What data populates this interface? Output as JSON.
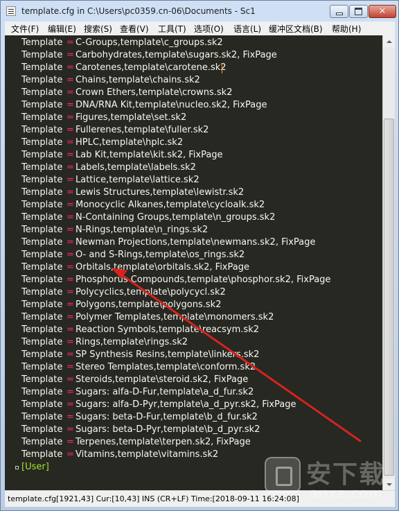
{
  "window": {
    "title": "template.cfg in C:\\Users\\pc0359.cn-06\\Documents - Sc1",
    "close_glyph": "✕"
  },
  "menu": [
    {
      "label": "文件(F)",
      "name": "menu-file"
    },
    {
      "label": "编辑(E)",
      "name": "menu-edit"
    },
    {
      "label": "搜索(S)",
      "name": "menu-search"
    },
    {
      "label": "查看(V)",
      "name": "menu-view"
    },
    {
      "label": "工具(T)",
      "name": "menu-tools"
    },
    {
      "label": "选项(O)",
      "name": "menu-options"
    },
    {
      "label": "语言(L)",
      "name": "menu-language"
    },
    {
      "label": "缓冲区文档(B)",
      "name": "menu-buffers"
    },
    {
      "label": "帮助(H)",
      "name": "menu-help"
    }
  ],
  "editor": {
    "key": "Template",
    "eq": "=",
    "lines": [
      "C-Groups,template\\c_groups.sk2",
      "Carbohydrates,template\\sugars.sk2, FixPage",
      "Carotenes,template\\carotene.sk2",
      "Chains,template\\chains.sk2",
      "Crown Ethers,template\\crowns.sk2",
      "DNA/RNA Kit,template\\nucleo.sk2, FixPage",
      "Figures,template\\set.sk2",
      "Fullerenes,template\\fuller.sk2",
      "HPLC,template\\hplc.sk2",
      "Lab Kit,template\\kit.sk2, FixPage",
      "Labels,template\\labels.sk2",
      "Lattice,template\\lattice.sk2",
      "Lewis Structures,template\\lewistr.sk2",
      "Monocyclic Alkanes,template\\cycloalk.sk2",
      "N-Containing Groups,template\\n_groups.sk2",
      "N-Rings,template\\n_rings.sk2",
      "Newman Projections,template\\newmans.sk2, FixPage",
      "O- and S-Rings,template\\os_rings.sk2",
      "Orbitals,template\\orbitals.sk2, FixPage",
      "Phosphorus Compounds,template\\phosphor.sk2, FixPage",
      "Polycyclics,template\\polycycl.sk2",
      "Polygons,template\\polygons.sk2",
      "Polymer Templates,template\\monomers.sk2",
      "Reaction Symbols,template\\reacsym.sk2",
      "Rings,template\\rings.sk2",
      "SP Synthesis Resins,template\\linkers.sk2",
      "Stereo Templates,template\\conform.sk2",
      "Steroids,template\\steroid.sk2, FixPage",
      "Sugars: alfa-D-Fur,template\\a_d_fur.sk2",
      "Sugars: alfa-D-Pyr,template\\a_d_pyr.sk2, FixPage",
      "Sugars: beta-D-Fur,template\\b_d_fur.sk2",
      "Sugars: beta-D-Pyr,template\\b_d_pyr.sk2",
      "Terpenes,template\\terpen.sk2, FixPage",
      "Vitamins,template\\vitamins.sk2"
    ],
    "section": "[User]",
    "colors": {
      "background": "#272822",
      "key": "#f8f8f2",
      "operator": "#f92672",
      "section": "#a6e22e",
      "caret": "#fd971f"
    }
  },
  "status": {
    "text": "template.cfg[1921,43] Cur:[10,43] INS (CR+LF)  Time:[2018-09-11 16:24:08]"
  },
  "annotation": {
    "arrow_color": "#d9221c"
  },
  "watermark": {
    "text": "安下载",
    "url": "anxz.com"
  }
}
